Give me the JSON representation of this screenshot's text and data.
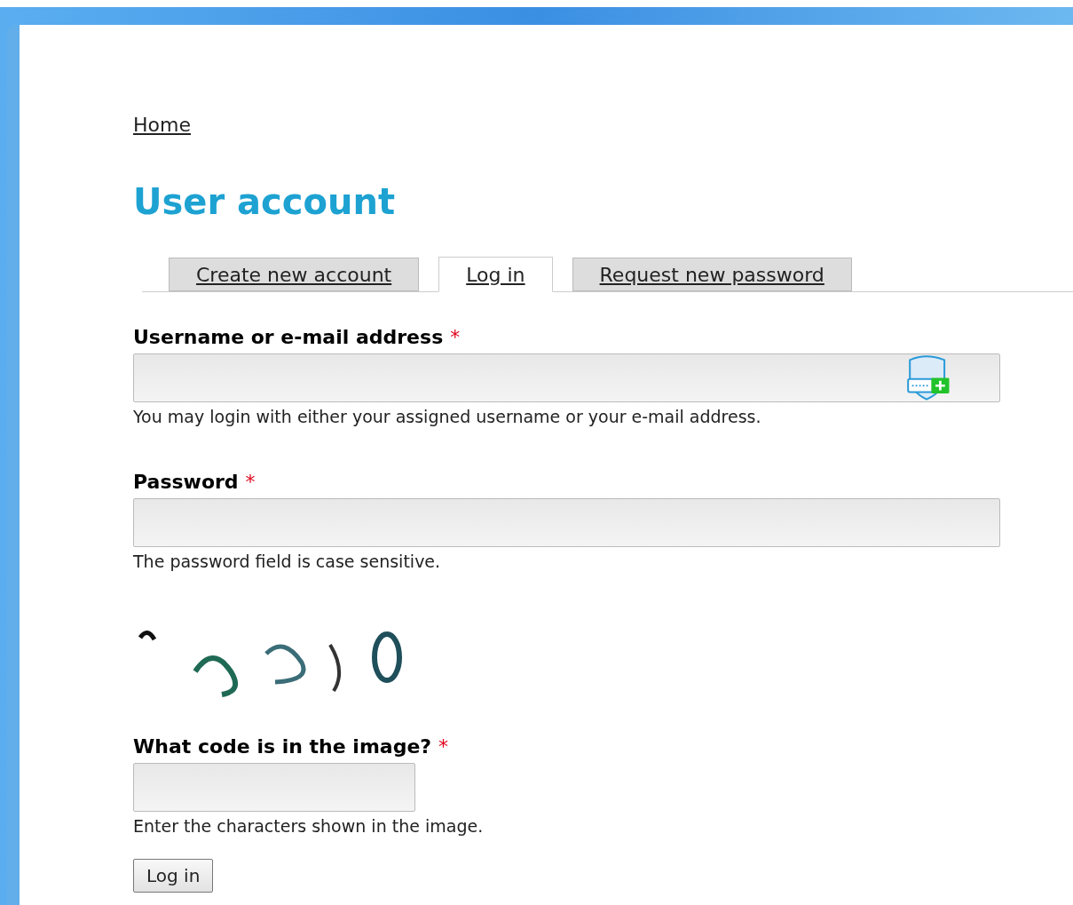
{
  "breadcrumb": {
    "label": "Home"
  },
  "title": "User account",
  "tabs": [
    {
      "label": "Create new account",
      "selected": false
    },
    {
      "label": "Log in",
      "selected": true
    },
    {
      "label": "Request new password",
      "selected": false
    }
  ],
  "fields": [
    {
      "label": "Username or e-mail address",
      "required": "*",
      "description": "You may login with either your assigned username or your e-mail address.",
      "password_manager_icon": true
    },
    {
      "label": "Password",
      "required": "*",
      "description": "The password field is case sensitive.",
      "password_manager_icon": false
    }
  ],
  "captcha": {
    "label": "What code is in the image?",
    "required": "*",
    "description": "Enter the characters shown in the image."
  },
  "submit": "Log in"
}
